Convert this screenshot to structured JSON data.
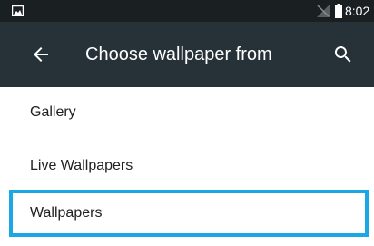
{
  "status_bar": {
    "time": "8:02",
    "icons": [
      "gallery-icon",
      "no-signal-icon",
      "battery-icon"
    ]
  },
  "toolbar": {
    "title": "Choose wallpaper from",
    "back_icon": "arrow-left-icon",
    "search_icon": "search-icon"
  },
  "list": {
    "items": [
      {
        "label": "Gallery"
      },
      {
        "label": "Live Wallpapers"
      },
      {
        "label": "Wallpapers",
        "selected": true
      }
    ]
  },
  "colors": {
    "status_bar_bg": "#1a1f22",
    "toolbar_bg": "#263238",
    "highlight": "#1aa7e4"
  }
}
